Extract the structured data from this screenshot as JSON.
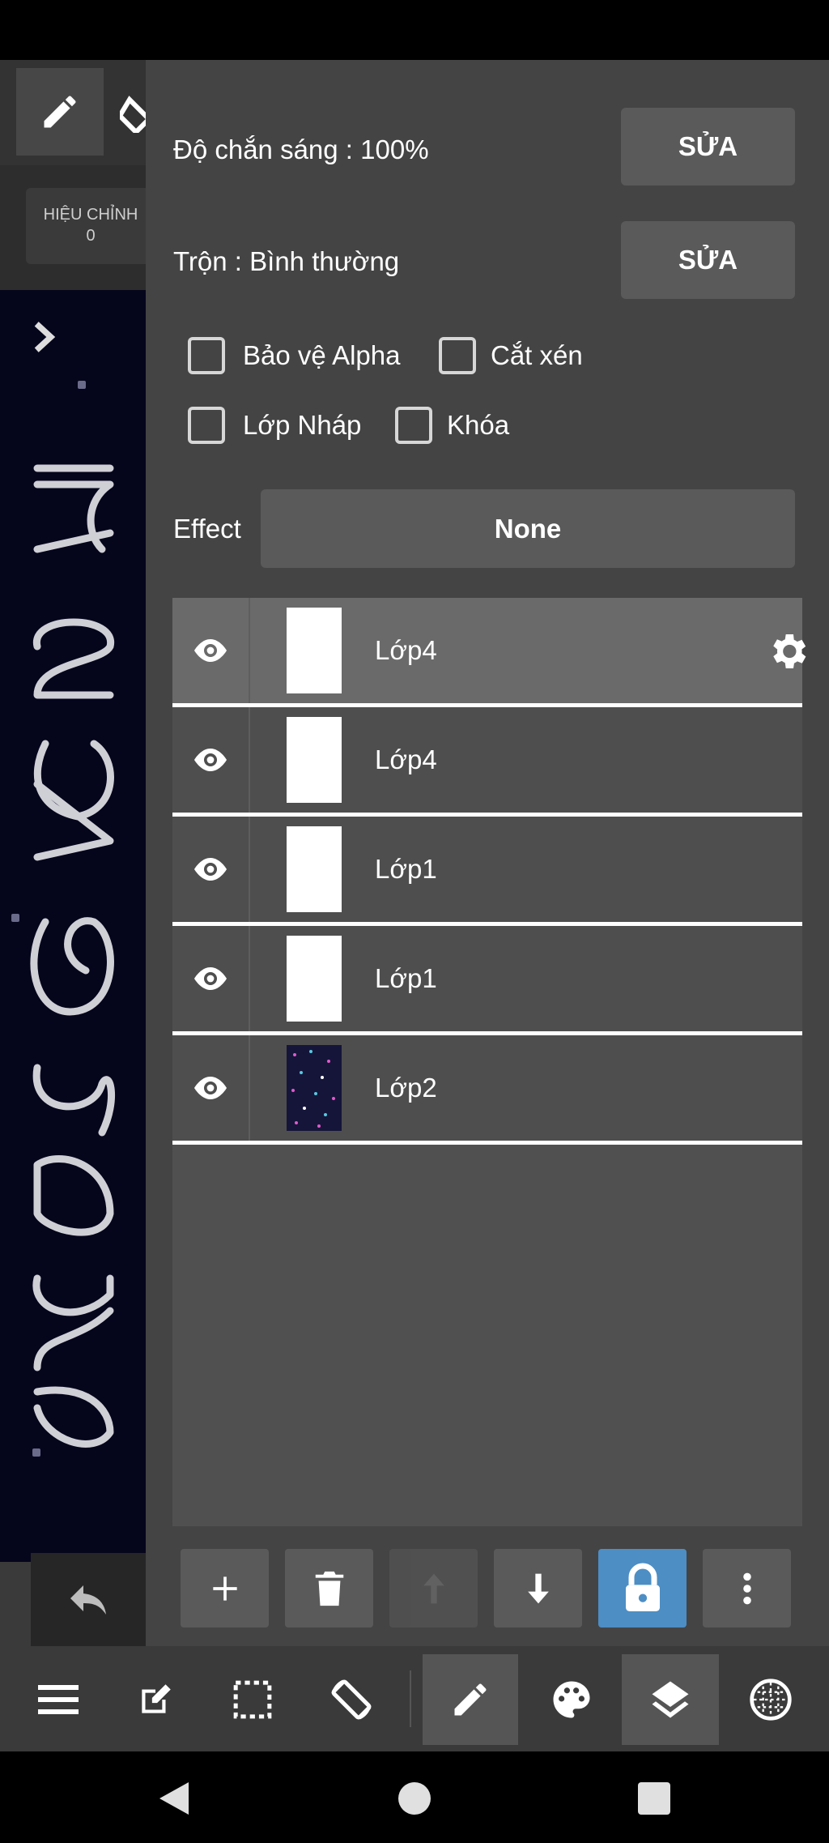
{
  "canvas": {
    "adjust_label": "HIỆU CHỈNH",
    "adjust_value": "0"
  },
  "layer_panel": {
    "opacity_label": "Độ chắn sáng : 100%",
    "opacity_edit": "SỬA",
    "blend_label": "Trộn : Bình thường",
    "blend_edit": "SỬA",
    "options": {
      "alpha_protect": "Bảo vệ Alpha",
      "clipping": "Cắt xén",
      "draft_layer": "Lớp Nháp",
      "lock": "Khóa"
    },
    "effect_label": "Effect",
    "effect_value": "None",
    "layers": [
      {
        "name": "Lớp4",
        "active": true,
        "thumb": "white"
      },
      {
        "name": "Lớp4",
        "active": false,
        "thumb": "white"
      },
      {
        "name": "Lớp1",
        "active": false,
        "thumb": "white"
      },
      {
        "name": "Lớp1",
        "active": false,
        "thumb": "white"
      },
      {
        "name": "Lớp2",
        "active": false,
        "thumb": "night-sky"
      }
    ],
    "actions": [
      "add-icon",
      "trash-icon",
      "arrow-up-icon",
      "arrow-down-icon",
      "lock-icon",
      "more-vertical-icon"
    ]
  },
  "bottom_toolbar": [
    "menu-icon",
    "edit-icon",
    "selection-icon",
    "rotate-icon",
    "pen-icon",
    "palette-icon",
    "layers-icon",
    "grid-circle-icon"
  ],
  "colors": {
    "panel_bg": "#444444",
    "button_bg": "#5a5a5a",
    "lock_accent": "#4d8ec4",
    "canvas_bg": "#05051c"
  }
}
